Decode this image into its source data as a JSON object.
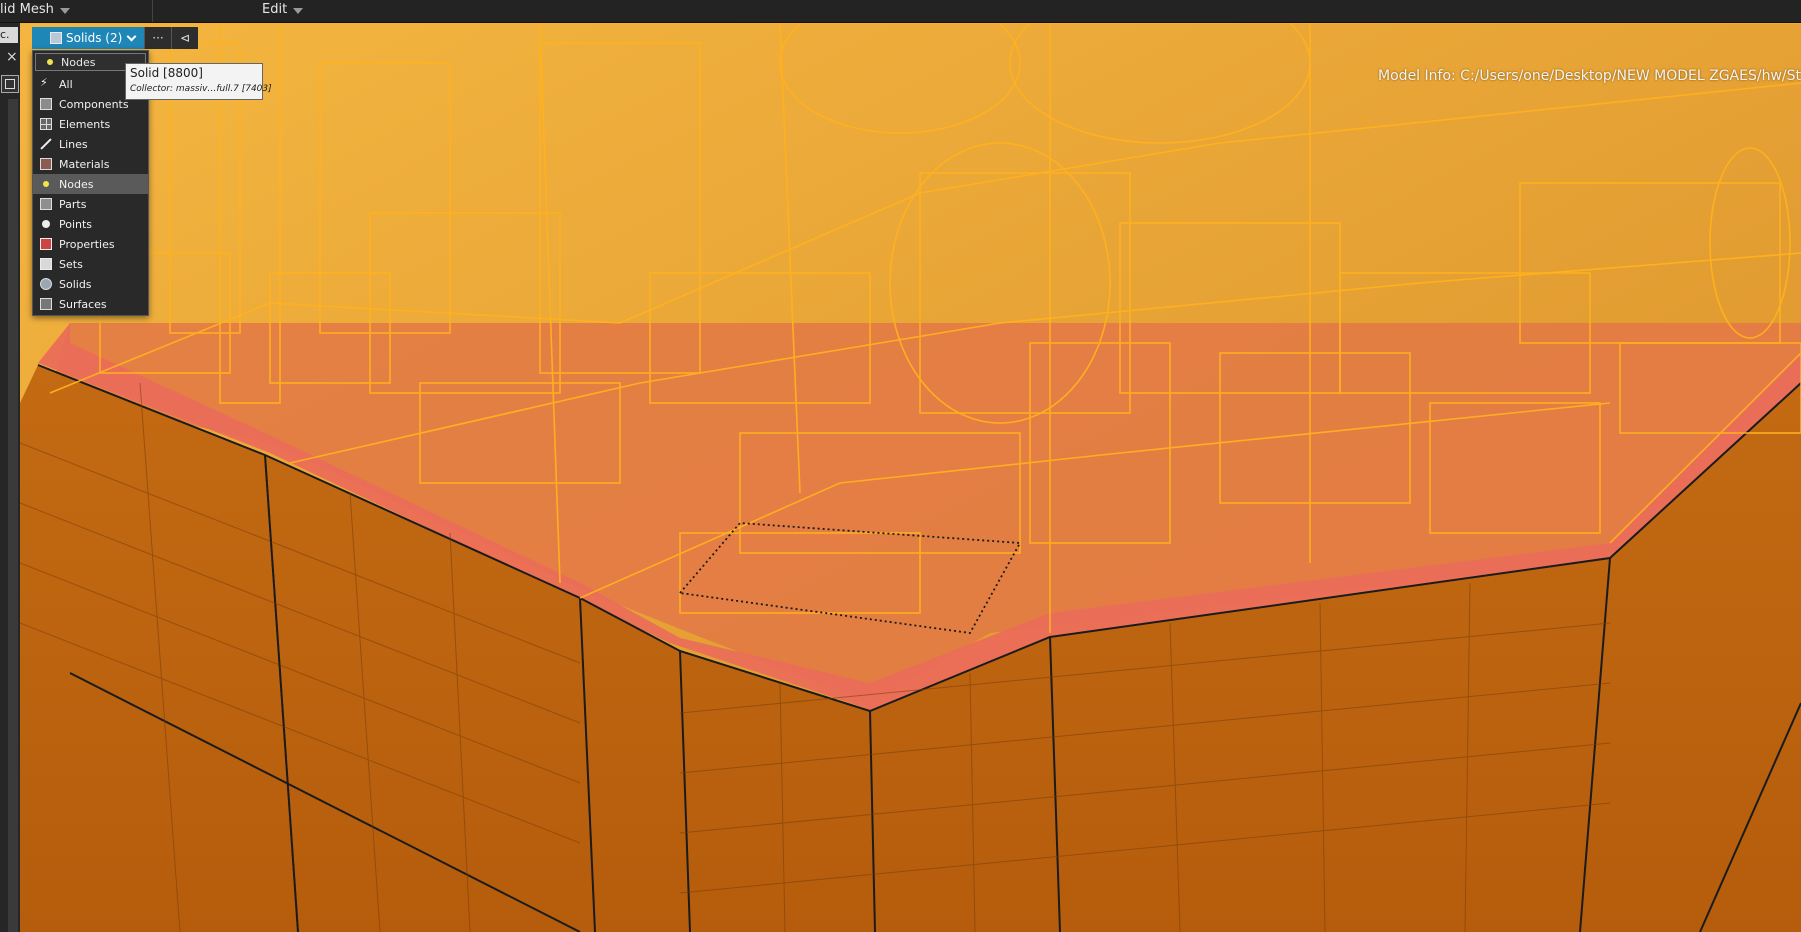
{
  "menubar": {
    "left_label": "lid Mesh",
    "edit_label": "Edit"
  },
  "left_panel": {
    "tab_label": "c.",
    "close_symbol": "×"
  },
  "viewport": {
    "model_info": "Model Info: C:/Users/one/Desktop/NEW MODEL ZGAES/hw/St"
  },
  "selector": {
    "button_label": "Solids (2)",
    "more_label": "···",
    "back_label": "⊲",
    "search_value": "Nodes",
    "items": [
      {
        "label": "All",
        "icon": "lightning-icon"
      },
      {
        "label": "Components",
        "icon": "component-icon"
      },
      {
        "label": "Elements",
        "icon": "element-icon"
      },
      {
        "label": "Lines",
        "icon": "line-icon"
      },
      {
        "label": "Materials",
        "icon": "material-icon"
      },
      {
        "label": "Nodes",
        "icon": "node-icon",
        "selected": true
      },
      {
        "label": "Parts",
        "icon": "part-icon"
      },
      {
        "label": "Points",
        "icon": "point-icon"
      },
      {
        "label": "Properties",
        "icon": "property-icon"
      },
      {
        "label": "Sets",
        "icon": "set-icon"
      },
      {
        "label": "Solids",
        "icon": "solid-icon"
      },
      {
        "label": "Surfaces",
        "icon": "surface-icon"
      }
    ]
  },
  "tooltip": {
    "line1": "Solid  [8800]",
    "line2": "Collector: massiv…full.7  [7403]"
  }
}
